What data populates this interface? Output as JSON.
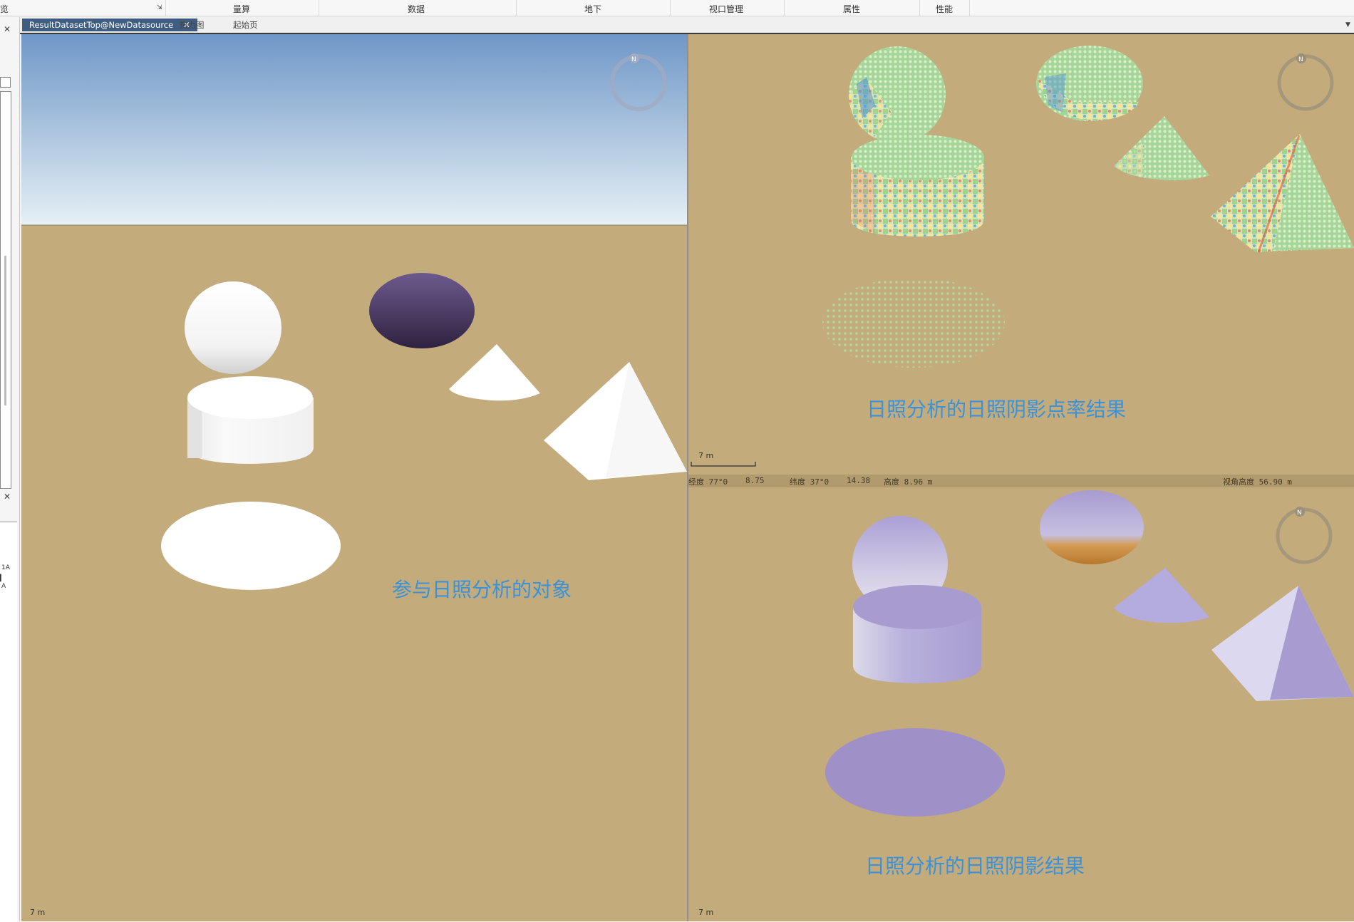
{
  "ribbon": {
    "groups": [
      "览",
      "量算",
      "数据",
      "地下",
      "视口管理",
      "属性",
      "性能"
    ]
  },
  "tabs": {
    "active": "ResultDatasetTop@NewDatasource",
    "others": [
      "热力图",
      "起始页"
    ]
  },
  "left_panel": {
    "close_glyph": "✕",
    "items": [
      "1A",
      "A"
    ]
  },
  "viewports": {
    "left_caption": "参与日照分析的对象",
    "top_right_caption": "日照分析的日照阴影点率结果",
    "bottom_right_caption": "日照分析的日照阴影结果",
    "compass_label": "N",
    "scale_label": "7 m"
  },
  "status": {
    "items": [
      "经度 77°0",
      "8.75",
      "纬度 37°0",
      "14.38",
      "高度 8.96 m",
      "视角高度 56.90 m"
    ]
  },
  "colors": {
    "ground": "#c3ab7c",
    "sky_top": "#6f97c7",
    "sky_bottom": "#e6f0f5",
    "caption": "#3a92da",
    "shadow_purple": "#a79bd0"
  }
}
